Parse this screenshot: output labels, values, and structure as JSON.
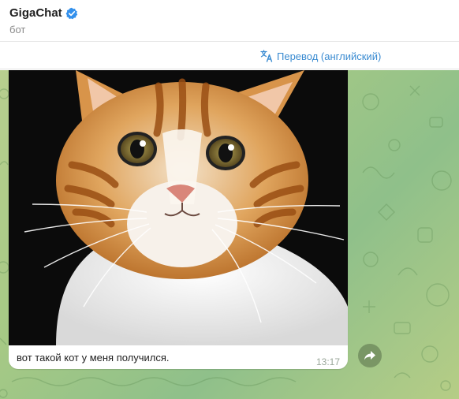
{
  "header": {
    "title": "GigaChat",
    "subtitle": "бот",
    "verified_icon": "verified-badge-icon",
    "verified_color": "#3390ec"
  },
  "translate": {
    "label": "Перевод (английский)",
    "icon": "translate-icon",
    "color": "#3a8bd1"
  },
  "message": {
    "image_alt": "cat-portrait-image",
    "caption": "вот такой кот у меня получился.",
    "time": "13:17",
    "forward_icon": "share-arrow-icon"
  },
  "colors": {
    "chat_background": "#a6c985",
    "bubble": "#ffffff"
  }
}
